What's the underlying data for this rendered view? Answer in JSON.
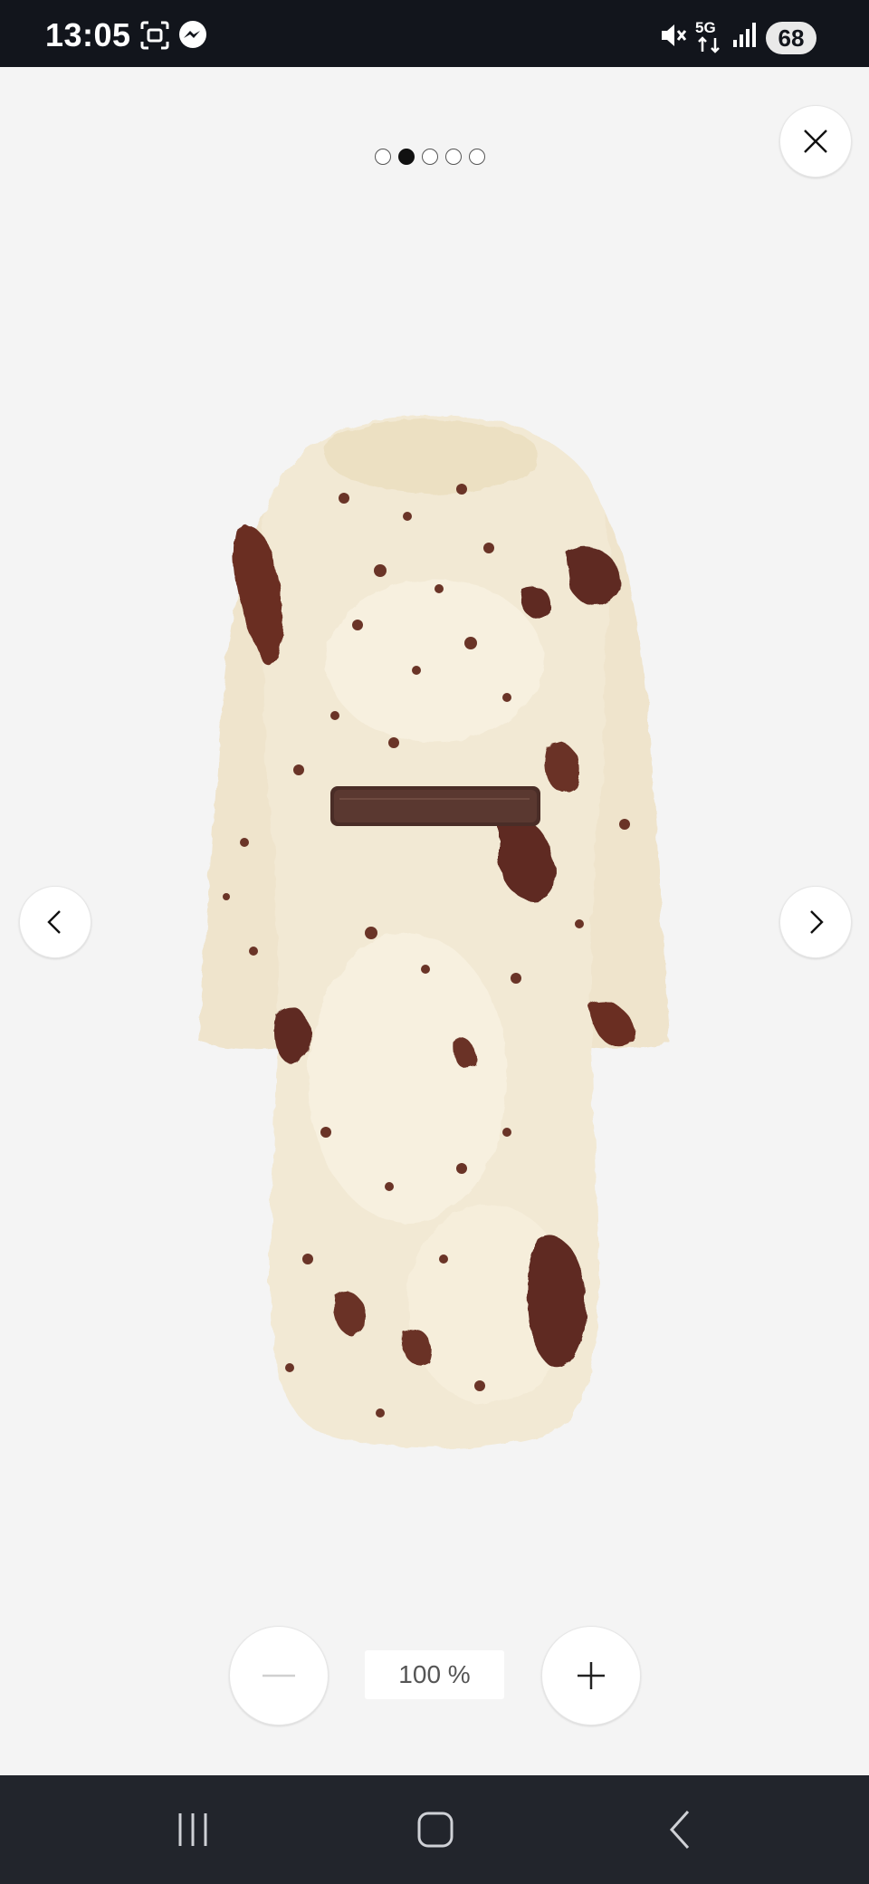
{
  "status_bar": {
    "time": "13:05",
    "icons": [
      "screenshot-icon",
      "messenger-icon",
      "mute-icon",
      "5g-icon",
      "signal-icon"
    ],
    "battery": "68"
  },
  "gallery": {
    "slide_count": 5,
    "active_index": 1,
    "image": "fur-coat-back-view"
  },
  "zoom": {
    "level": "100 %"
  },
  "colors": {
    "background": "#f4f4f4",
    "status_bar": "#12151c",
    "nav_bar": "#22252c"
  }
}
